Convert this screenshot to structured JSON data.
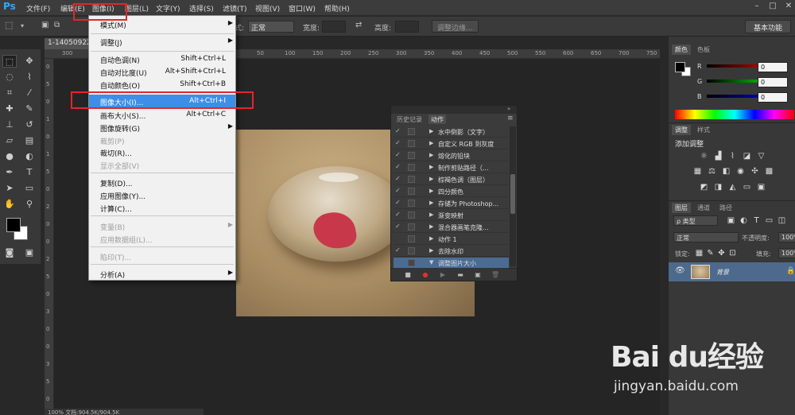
{
  "app": {
    "logo": "Ps"
  },
  "menubar": {
    "items": [
      "文件(F)",
      "编辑(E)",
      "图像(I)",
      "图层(L)",
      "文字(Y)",
      "选择(S)",
      "滤镜(T)",
      "视图(V)",
      "窗口(W)",
      "帮助(H)"
    ],
    "window_controls": [
      "–",
      "□",
      "✕"
    ]
  },
  "options": {
    "style_label": "式:",
    "style_value": "正常",
    "width_label": "宽度:",
    "height_label": "高度:",
    "refine_button": "调整边缘...",
    "workspace": "基本功能"
  },
  "document": {
    "tab_title": "1-14050922",
    "ruler_h_ticks": [
      "300",
      "250",
      "200",
      "150",
      "100",
      "50",
      "0",
      "50",
      "100",
      "150",
      "200",
      "250",
      "300",
      "350",
      "400",
      "450",
      "500",
      "550",
      "600",
      "650",
      "700",
      "750"
    ],
    "ruler_v_ticks": [
      "0",
      "5",
      "0",
      "1",
      "0",
      "1",
      "5",
      "0",
      "2",
      "0",
      "0",
      "2",
      "5",
      "0",
      "3",
      "0",
      "0",
      "3",
      "5",
      "0"
    ],
    "status": "100%      文档:904.5K/904.5K"
  },
  "image_menu": {
    "items": [
      {
        "label": "模式(M)",
        "shortcut": "",
        "arrow": "▶",
        "disabled": false
      },
      {
        "label": "调整(J)",
        "shortcut": "",
        "arrow": "▶",
        "disabled": false
      },
      {
        "label": "自动色调(N)",
        "shortcut": "Shift+Ctrl+L",
        "arrow": "",
        "disabled": false
      },
      {
        "label": "自动对比度(U)",
        "shortcut": "Alt+Shift+Ctrl+L",
        "arrow": "",
        "disabled": false
      },
      {
        "label": "自动颜色(O)",
        "shortcut": "Shift+Ctrl+B",
        "arrow": "",
        "disabled": false
      },
      {
        "label": "图像大小(I)...",
        "shortcut": "Alt+Ctrl+I",
        "arrow": "",
        "disabled": false
      },
      {
        "label": "画布大小(S)...",
        "shortcut": "Alt+Ctrl+C",
        "arrow": "",
        "disabled": false
      },
      {
        "label": "图像旋转(G)",
        "shortcut": "",
        "arrow": "▶",
        "disabled": false
      },
      {
        "label": "裁剪(P)",
        "shortcut": "",
        "arrow": "",
        "disabled": true
      },
      {
        "label": "裁切(R)...",
        "shortcut": "",
        "arrow": "",
        "disabled": false
      },
      {
        "label": "显示全部(V)",
        "shortcut": "",
        "arrow": "",
        "disabled": true
      },
      {
        "label": "复制(D)...",
        "shortcut": "",
        "arrow": "",
        "disabled": false
      },
      {
        "label": "应用图像(Y)...",
        "shortcut": "",
        "arrow": "",
        "disabled": false
      },
      {
        "label": "计算(C)...",
        "shortcut": "",
        "arrow": "",
        "disabled": false
      },
      {
        "label": "变量(B)",
        "shortcut": "",
        "arrow": "▶",
        "disabled": true
      },
      {
        "label": "应用数据组(L)...",
        "shortcut": "",
        "arrow": "",
        "disabled": true
      },
      {
        "label": "陷印(T)...",
        "shortcut": "",
        "arrow": "",
        "disabled": true
      },
      {
        "label": "分析(A)",
        "shortcut": "",
        "arrow": "▶",
        "disabled": false
      }
    ]
  },
  "actions_panel": {
    "tabs": [
      "历史记录",
      "动作"
    ],
    "rows": [
      {
        "check": "✓",
        "name": "水中倒影（文字）",
        "selected": false
      },
      {
        "check": "✓",
        "name": "自定义 RGB 到灰度",
        "selected": false
      },
      {
        "check": "✓",
        "name": "熔化的铅块",
        "selected": false
      },
      {
        "check": "✓",
        "name": "制作剪贴路径（...",
        "selected": false
      },
      {
        "check": "✓",
        "name": "棕褐色调（图层）",
        "selected": false
      },
      {
        "check": "✓",
        "name": "四分颜色",
        "selected": false
      },
      {
        "check": "✓",
        "name": "存储为 Photoshop...",
        "selected": false
      },
      {
        "check": "✓",
        "name": "渐变映射",
        "selected": false
      },
      {
        "check": "✓",
        "name": "混合器画笔克隆...",
        "selected": false
      },
      {
        "check": "",
        "name": "动作 1",
        "selected": false
      },
      {
        "check": "✓",
        "name": "去除水印",
        "selected": false
      },
      {
        "check": "",
        "name": "调整图片大小",
        "selected": true
      }
    ],
    "footer_buttons": [
      "■",
      "●",
      "▶",
      "▬",
      "▣",
      "🗑"
    ]
  },
  "color_panel": {
    "tabs": [
      "颜色",
      "色板"
    ],
    "channels": [
      {
        "label": "R",
        "value": "0"
      },
      {
        "label": "G",
        "value": "0"
      },
      {
        "label": "B",
        "value": "0"
      }
    ]
  },
  "adjust_panel": {
    "tabs": [
      "调整",
      "样式"
    ],
    "title": "添加调整"
  },
  "layers_panel": {
    "tabs": [
      "图层",
      "通道",
      "路径"
    ],
    "filter": "ρ 类型",
    "blend": "正常",
    "opacity_label": "不透明度:",
    "opacity_value": "100%",
    "lock_label": "锁定:",
    "fill_label": "填充:",
    "fill_value": "100%",
    "layer_name": "背景"
  },
  "watermark": {
    "brand": "Bai du经验",
    "url": "jingyan.baidu.com"
  },
  "colors": {
    "accent": "#3d8ee8",
    "annotation": "#e2262c",
    "selected_action": "#4a6c93"
  }
}
